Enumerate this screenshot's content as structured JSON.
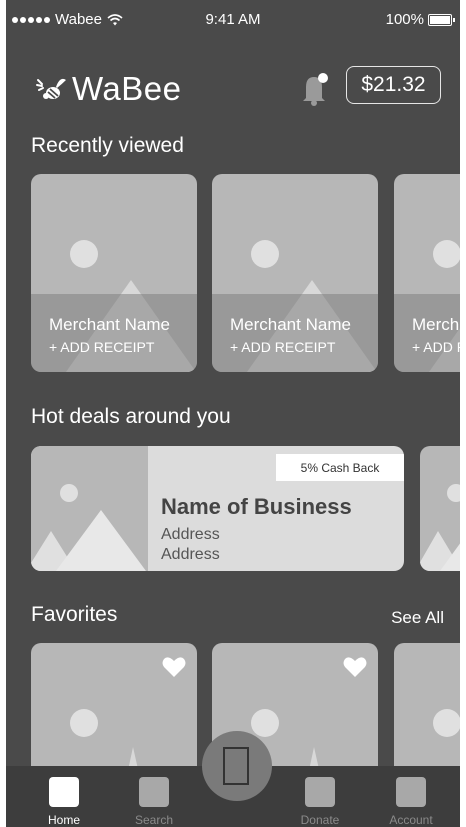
{
  "status_bar": {
    "carrier": "Wabee",
    "time": "9:41 AM",
    "battery": "100%"
  },
  "header": {
    "logo_text": "WaBee",
    "balance": "$21.32"
  },
  "recently_viewed": {
    "title": "Recently viewed",
    "cards": [
      {
        "name": "Merchant Name",
        "action": "+ ADD RECEIPT"
      },
      {
        "name": "Merchant Name",
        "action": "+ ADD RECEIPT"
      },
      {
        "name": "Merchant Name",
        "action": "+ ADD RECEIPT"
      }
    ]
  },
  "hot_deals": {
    "title": "Hot deals around you",
    "deal": {
      "tag": "5% Cash Back",
      "business": "Name of Business",
      "address_line1": "Address",
      "address_line2": "Address"
    }
  },
  "favorites": {
    "title": "Favorites",
    "see_all": "See All"
  },
  "tab_bar": {
    "items": [
      {
        "label": "Home",
        "active": true
      },
      {
        "label": "Search",
        "active": false
      },
      {
        "label": "Donate",
        "active": false
      },
      {
        "label": "Account",
        "active": false
      }
    ]
  },
  "colors": {
    "background": "#4a4a4a",
    "placeholder": "#b7b7b7",
    "tab_bar": "#3d3d3d"
  }
}
